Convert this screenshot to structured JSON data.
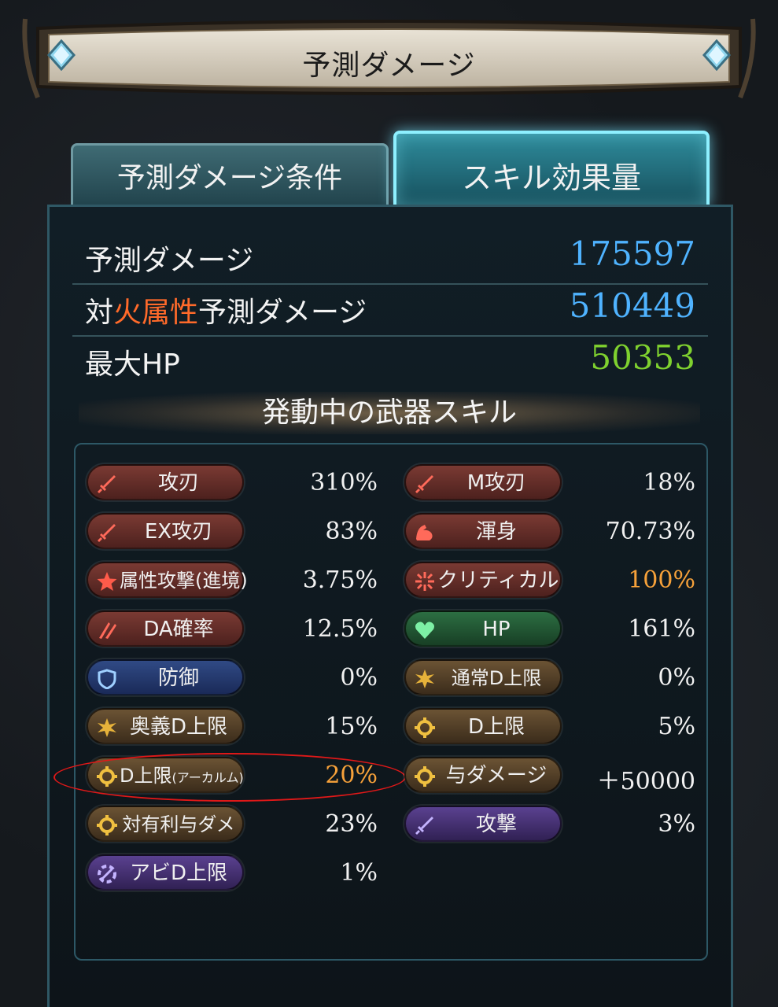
{
  "window": {
    "title": "予測ダメージ"
  },
  "tabs": [
    {
      "label": "予測ダメージ条件",
      "active": false
    },
    {
      "label": "スキル効果量",
      "active": true
    }
  ],
  "stats": [
    {
      "label": "予測ダメージ",
      "value": "175597",
      "color": "#4fb3ff"
    },
    {
      "label_prefix": "対",
      "label_fire": "火属性",
      "label_suffix": "予測ダメージ",
      "value": "510449",
      "color": "#4fb3ff"
    },
    {
      "label": "最大HP",
      "value": "50353",
      "color": "#7fd12f"
    }
  ],
  "section": {
    "heading": "発動中の武器スキル"
  },
  "skills": {
    "left": [
      {
        "label": "攻刃",
        "value": "310%",
        "icon": "sword-icon",
        "style": "red"
      },
      {
        "label": "EX攻刃",
        "value": "83%",
        "icon": "sword-icon",
        "style": "red"
      },
      {
        "label": "属性攻撃(進境)",
        "value": "3.75%",
        "icon": "star-icon",
        "style": "red"
      },
      {
        "label": "DA確率",
        "value": "12.5%",
        "icon": "double-slash-icon",
        "style": "red"
      },
      {
        "label": "防御",
        "value": "0%",
        "icon": "shield-icon",
        "style": "blue"
      },
      {
        "label": "奥義D上限",
        "value": "15%",
        "icon": "burst-icon",
        "style": "brown"
      },
      {
        "label_main": "D上限",
        "label_sub": "(アーカルム)",
        "value": "20%",
        "icon": "gear-icon",
        "style": "brown",
        "highlighted": true
      },
      {
        "label": "対有利与ダメ",
        "value": "23%",
        "icon": "gear-icon",
        "style": "brown"
      },
      {
        "label": "アビD上限",
        "value": "1%",
        "icon": "ability-icon",
        "style": "purple"
      }
    ],
    "right": [
      {
        "label": "M攻刃",
        "value": "18%",
        "icon": "sword-icon",
        "style": "red"
      },
      {
        "label": "渾身",
        "value": "70.73%",
        "icon": "muscle-icon",
        "style": "red"
      },
      {
        "label": "クリティカル",
        "value": "100%",
        "icon": "critical-icon",
        "style": "red",
        "value_color": "orange"
      },
      {
        "label": "HP",
        "value": "161%",
        "icon": "heart-icon",
        "style": "green"
      },
      {
        "label": "通常D上限",
        "value": "0%",
        "icon": "burst-icon",
        "style": "brown"
      },
      {
        "label": "D上限",
        "value": "5%",
        "icon": "gear-icon",
        "style": "brown"
      },
      {
        "label": "与ダメージ",
        "value": "＋50000",
        "icon": "gear-icon",
        "style": "brown"
      },
      {
        "label": "攻撃",
        "value": "3%",
        "icon": "sword-icon",
        "style": "purple"
      }
    ]
  },
  "colors": {
    "fire": "#ff6a2a",
    "damage_value": "#4fb3ff",
    "hp_value": "#7fd12f",
    "highlight_value": "#f6a13a",
    "annotation": "#e01818"
  }
}
